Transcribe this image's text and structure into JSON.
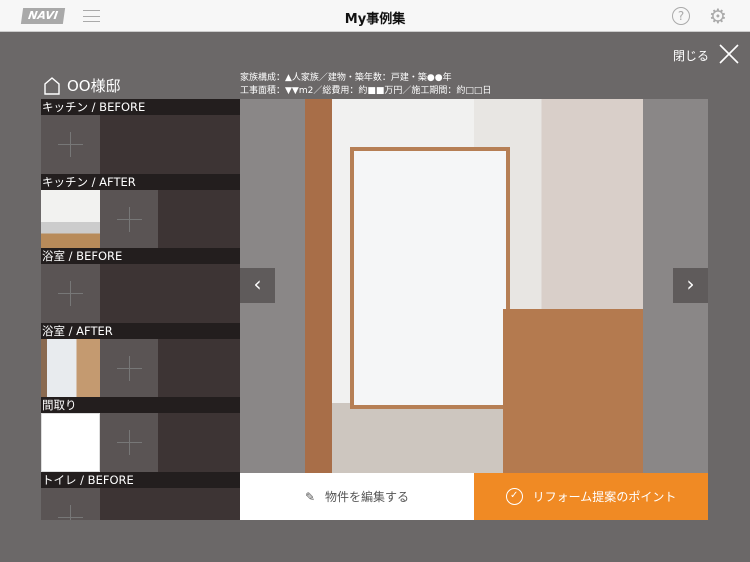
{
  "header": {
    "logo": "NAVI",
    "title": "My事例集"
  },
  "close_label": "閉じる",
  "property": {
    "name": "OO様邸",
    "info_line1": "家族構成：▲人家族／建物・築年数：戸建・築●●年",
    "info_line2": "工事面積：▼▼m2／総費用：約■■万円／施工期間：約□□日"
  },
  "sections": [
    {
      "label": "キッチン / BEFORE",
      "photos": []
    },
    {
      "label": "キッチン / AFTER",
      "photos": [
        "ph"
      ]
    },
    {
      "label": "浴室 / BEFORE",
      "photos": []
    },
    {
      "label": "浴室 / AFTER",
      "photos": [
        "ph2"
      ]
    },
    {
      "label": "間取り",
      "photos": [
        "ph3"
      ]
    },
    {
      "label": "トイレ / BEFORE",
      "photos": []
    }
  ],
  "buttons": {
    "edit": "物件を編集する",
    "point": "リフォーム提案のポイント"
  },
  "colors": {
    "accent": "#f08a24"
  }
}
